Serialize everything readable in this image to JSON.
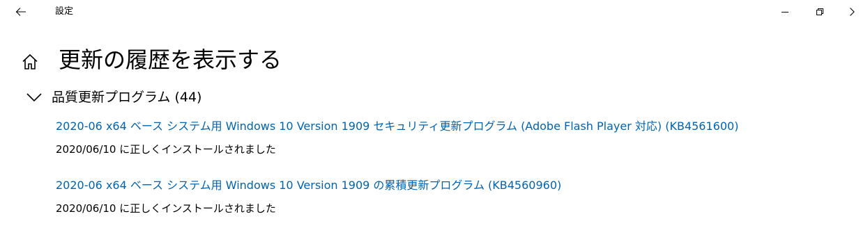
{
  "titlebar": {
    "title": "設定",
    "back_icon": "arrow-left-icon",
    "minimize_icon": "minimize-icon",
    "restore_icon": "restore-icon",
    "more_icon": "chevron-right-icon"
  },
  "page": {
    "home_icon": "home-icon",
    "title": "更新の履歴を表示する"
  },
  "section": {
    "expander_icon": "chevron-down-icon",
    "label": "品質更新プログラム (44)",
    "items": [
      {
        "link": "2020-06 x64 ベース システム用 Windows 10 Version 1909 セキュリティ更新プログラム (Adobe Flash Player 対応) (KB4561600)",
        "status": "2020/06/10 に正しくインストールされました"
      },
      {
        "link": "2020-06 x64 ベース システム用 Windows 10 Version 1909 の累積更新プログラム (KB4560960)",
        "status": "2020/06/10 に正しくインストールされました"
      }
    ]
  },
  "colors": {
    "link": "#0063b1",
    "text": "#000000",
    "background": "#ffffff"
  }
}
